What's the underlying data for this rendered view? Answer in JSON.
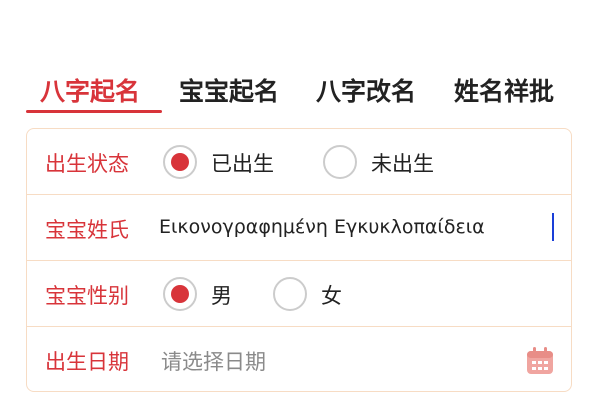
{
  "tabs": [
    {
      "label": "八字起名",
      "active": true
    },
    {
      "label": "宝宝起名",
      "active": false
    },
    {
      "label": "八字改名",
      "active": false
    },
    {
      "label": "姓名祥批",
      "active": false
    }
  ],
  "colors": {
    "accent": "#d8343a",
    "border": "#f7dcc4",
    "caret": "#1a3fd8",
    "calendar_icon": "#f0a5a0"
  },
  "form": {
    "birth_status": {
      "label": "出生状态",
      "options": [
        {
          "label": "已出生",
          "selected": true
        },
        {
          "label": "未出生",
          "selected": false
        }
      ]
    },
    "surname": {
      "label": "宝宝姓氏",
      "value": "Εικονογραφημένη Εγκυκλοπαίδεια"
    },
    "gender": {
      "label": "宝宝性别",
      "options": [
        {
          "label": "男",
          "selected": true
        },
        {
          "label": "女",
          "selected": false
        }
      ]
    },
    "birth_date": {
      "label": "出生日期",
      "placeholder": "请选择日期",
      "icon": "calendar-icon"
    }
  }
}
